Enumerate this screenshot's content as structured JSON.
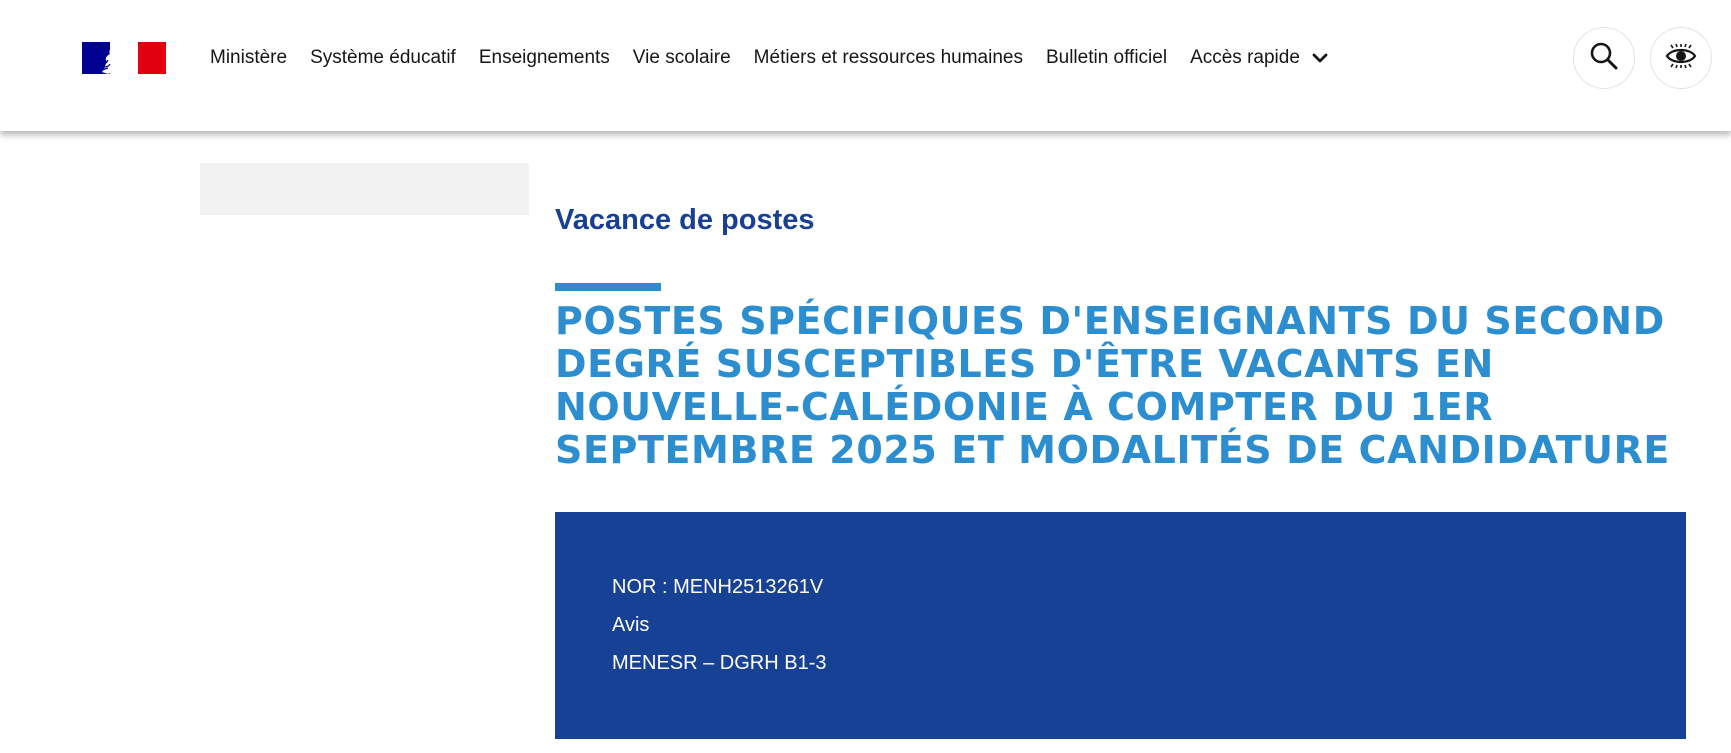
{
  "brand": {
    "colors": {
      "blue": "#000091",
      "red": "#e1000f",
      "accent": "#2c8dcf",
      "dark_blue": "#174194"
    }
  },
  "nav": {
    "items": [
      {
        "label": "Ministère"
      },
      {
        "label": "Système éducatif"
      },
      {
        "label": "Enseignements"
      },
      {
        "label": "Vie scolaire"
      },
      {
        "label": "Métiers et ressources humaines"
      },
      {
        "label": "Bulletin officiel"
      },
      {
        "label": "Accès rapide",
        "icon": "chevron-down-icon"
      }
    ]
  },
  "header_buttons": {
    "search_icon": "search-icon",
    "accessibility_icon": "eye-accessibility-icon"
  },
  "article": {
    "category": "Vacance de postes",
    "title": "Postes spécifiques d'enseignants du second degré susceptibles d'être vacants en Nouvelle-Calédonie à compter du 1er septembre 2025 et modalités de candidature",
    "info": {
      "nor": "NOR : MENH2513261V",
      "type": "Avis",
      "service": "MENESR – DGRH B1-3"
    }
  }
}
